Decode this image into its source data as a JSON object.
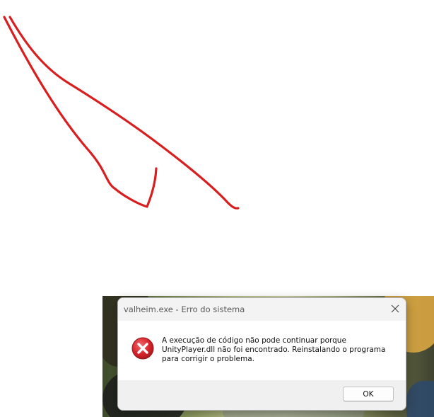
{
  "annotation": {
    "color": "#d81e1e",
    "icon": "red-scribble-arrow"
  },
  "dialog": {
    "title": "valheim.exe - Erro do sistema",
    "message": "A execução de código não pode continuar porque\nUnityPlayer.dll não foi encontrado. Reinstalando o programa\npara corrigir o problema.",
    "icon": "error-icon",
    "close_icon": "close-icon",
    "ok_label": "OK"
  },
  "colors": {
    "error_red": "#d9232b",
    "dialog_title_bg": "#f3f3f3",
    "footer_bg": "#f0f0f0"
  }
}
